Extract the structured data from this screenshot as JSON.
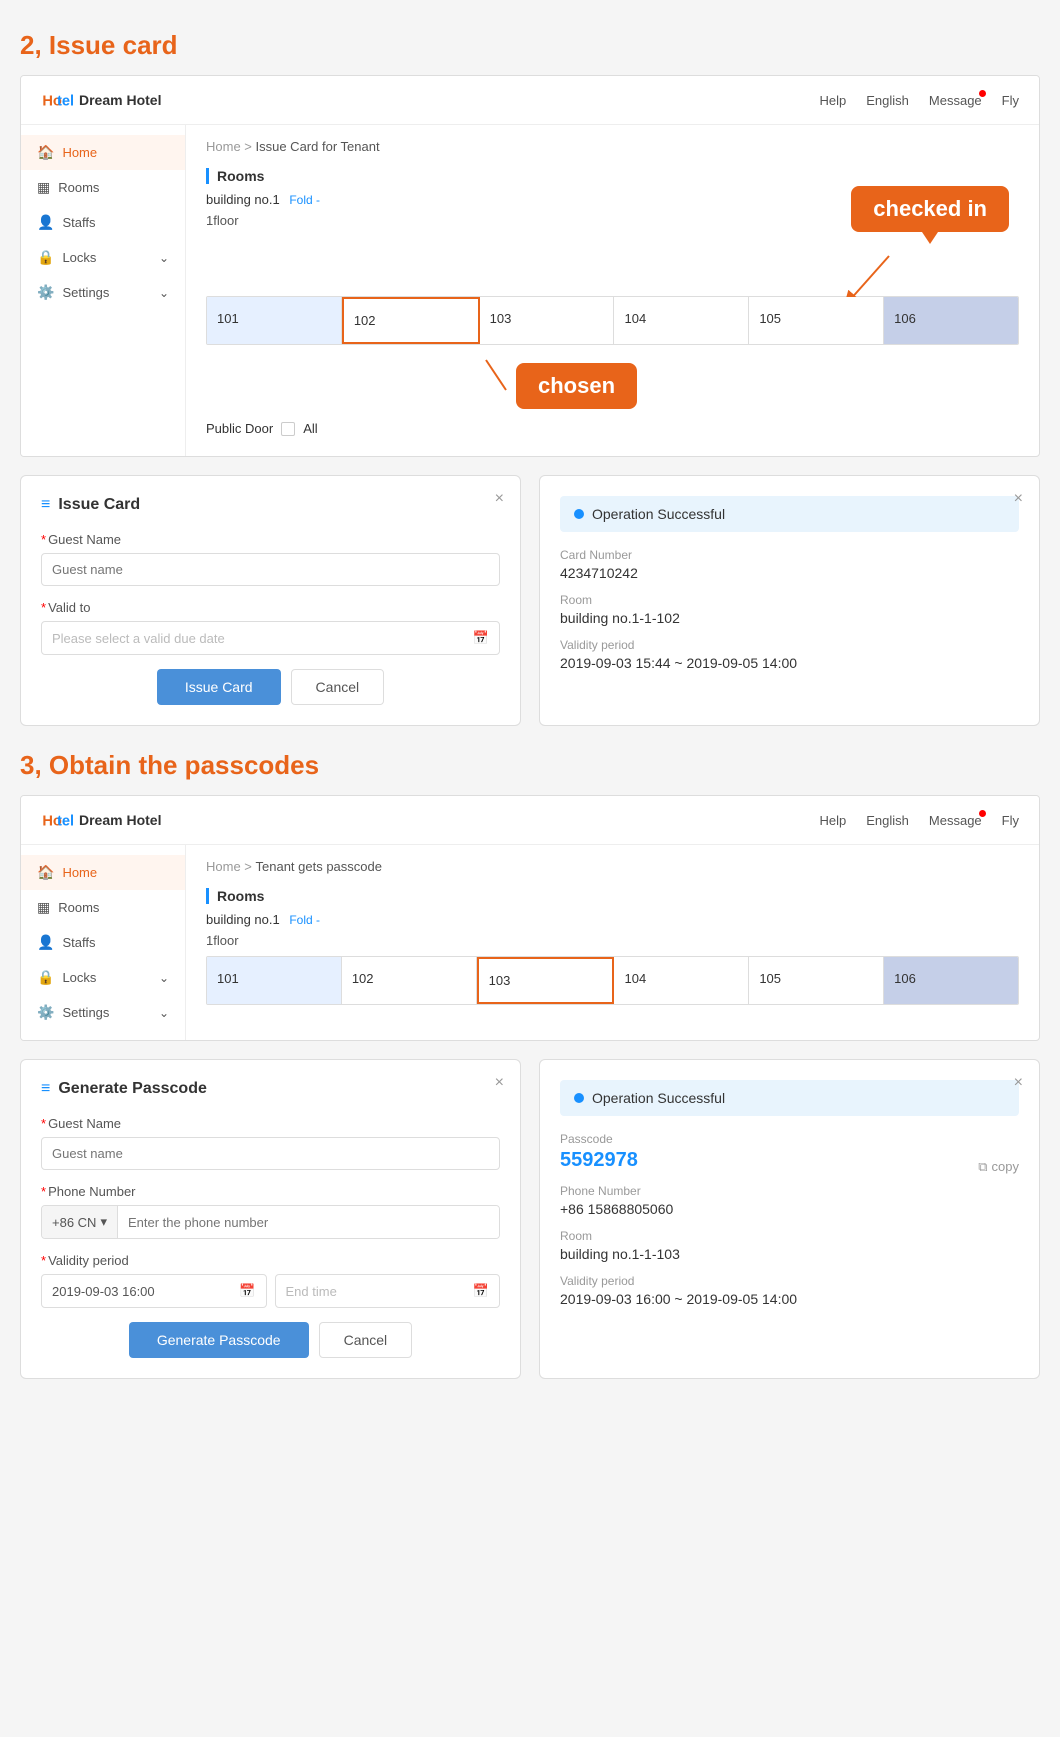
{
  "sections": [
    {
      "id": "issue-card",
      "title": "2, Issue card",
      "hotel": {
        "logo_text": "Dream Hotel",
        "nav": [
          "Help",
          "English",
          "Message",
          "Fly"
        ],
        "breadcrumb": [
          "Home",
          "Issue Card for Tenant"
        ],
        "sidebar": [
          {
            "label": "Home",
            "icon": "🏠",
            "active": true
          },
          {
            "label": "Rooms",
            "icon": "▦"
          },
          {
            "label": "Staffs",
            "icon": "👤"
          },
          {
            "label": "Locks",
            "icon": "🔒",
            "arrow": true
          },
          {
            "label": "Settings",
            "icon": "⚙️",
            "arrow": true
          }
        ],
        "rooms_section": "Rooms",
        "building": "building no.1",
        "fold_text": "Fold -",
        "floor": "1floor",
        "rooms": [
          "101",
          "102",
          "103",
          "104",
          "105",
          "106"
        ],
        "room_states": [
          "checked-in",
          "chosen",
          "normal",
          "normal",
          "normal",
          "dark-end"
        ],
        "public_door": "Public Door",
        "all_text": "All",
        "callout_checked_in": "checked in",
        "callout_chosen": "chosen"
      }
    },
    {
      "id": "obtain-passcodes",
      "title": "3, Obtain the passcodes",
      "hotel": {
        "logo_text": "Dream Hotel",
        "nav": [
          "Help",
          "English",
          "Message",
          "Fly"
        ],
        "breadcrumb": [
          "Home",
          "Tenant gets passcode"
        ],
        "sidebar": [
          {
            "label": "Home",
            "icon": "🏠",
            "active": true
          },
          {
            "label": "Rooms",
            "icon": "▦"
          },
          {
            "label": "Staffs",
            "icon": "👤"
          },
          {
            "label": "Locks",
            "icon": "🔒",
            "arrow": true
          },
          {
            "label": "Settings",
            "icon": "⚙️",
            "arrow": true
          }
        ],
        "rooms_section": "Rooms",
        "building": "building no.1",
        "fold_text": "Fold -",
        "floor": "1floor",
        "rooms": [
          "101",
          "102",
          "103",
          "104",
          "105",
          "106"
        ],
        "room_states": [
          "checked-in",
          "normal",
          "selected-orange",
          "normal",
          "normal",
          "dark-end"
        ]
      }
    }
  ],
  "issue_card_dialog": {
    "title": "Issue Card",
    "close": "×",
    "guest_name_label": "Guest Name",
    "guest_name_placeholder": "Guest name",
    "valid_to_label": "Valid to",
    "valid_to_placeholder": "Please select a valid due date",
    "issue_card_btn": "Issue Card",
    "cancel_btn": "Cancel"
  },
  "issue_success_dialog": {
    "close": "×",
    "success_text": "Operation Successful",
    "card_number_label": "Card Number",
    "card_number_value": "4234710242",
    "room_label": "Room",
    "room_value": "building no.1-1-102",
    "validity_label": "Validity period",
    "validity_value": "2019-09-03 15:44  ~  2019-09-05 14:00"
  },
  "generate_passcode_dialog": {
    "title": "Generate Passcode",
    "close": "×",
    "guest_name_label": "Guest Name",
    "guest_name_placeholder": "Guest name",
    "phone_label": "Phone Number",
    "phone_country": "+86 CN",
    "phone_placeholder": "Enter the phone number",
    "validity_label": "Validity period",
    "start_date": "2019-09-03 16:00",
    "end_time_placeholder": "End time",
    "generate_btn": "Generate Passcode",
    "cancel_btn": "Cancel"
  },
  "passcode_success_dialog": {
    "close": "×",
    "success_text": "Operation Successful",
    "passcode_label": "Passcode",
    "passcode_value": "5592978",
    "copy_text": "copy",
    "phone_label": "Phone Number",
    "phone_value": "+86 15868805060",
    "room_label": "Room",
    "room_value": "building no.1-1-103",
    "validity_label": "Validity period",
    "validity_value": "2019-09-03 16:00  ~  2019-09-05 14:00"
  }
}
